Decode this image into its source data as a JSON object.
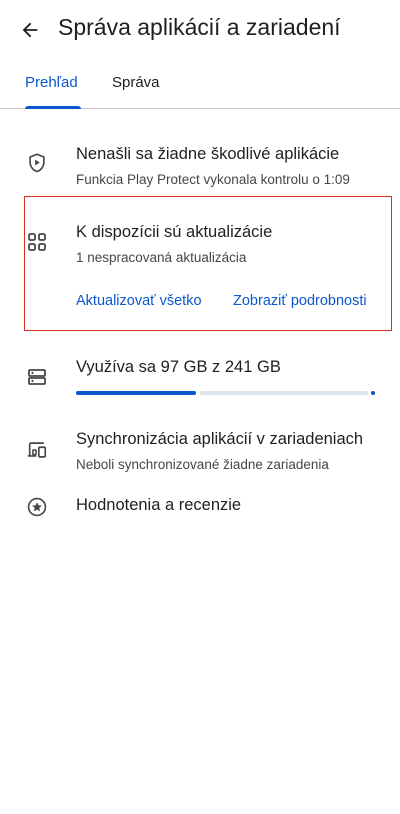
{
  "header": {
    "title": "Správa aplikácií a zariadení",
    "back_icon": "arrow-left-icon"
  },
  "tabs": [
    {
      "label": "Prehľad",
      "active": true
    },
    {
      "label": "Správa",
      "active": false
    }
  ],
  "play_protect": {
    "icon": "shield-play-icon",
    "title": "Nenašli sa žiadne škodlivé aplikácie",
    "subtitle": "Funkcia Play Protect vykonala kontrolu o 1:09"
  },
  "updates": {
    "icon": "apps-grid-icon",
    "title": "K dispozícii sú aktualizácie",
    "subtitle": "1 nespracovaná aktualizácia",
    "update_all_label": "Aktualizovať všetko",
    "details_label": "Zobraziť podrobnosti"
  },
  "storage": {
    "icon": "storage-icon",
    "title": "Využíva sa 97 GB z 241 GB",
    "used_gb": 97,
    "total_gb": 241
  },
  "sync": {
    "icon": "devices-sync-icon",
    "title": "Synchronizácia aplikácií v zariadeniach",
    "subtitle": "Neboli synchronizované žiadne zariadenia"
  },
  "ratings": {
    "icon": "star-circle-icon",
    "title": "Hodnotenia a recenzie"
  },
  "colors": {
    "accent": "#0b57d0",
    "highlight": "#d93025",
    "text": "#1f1f1f",
    "subtext": "#444746"
  }
}
